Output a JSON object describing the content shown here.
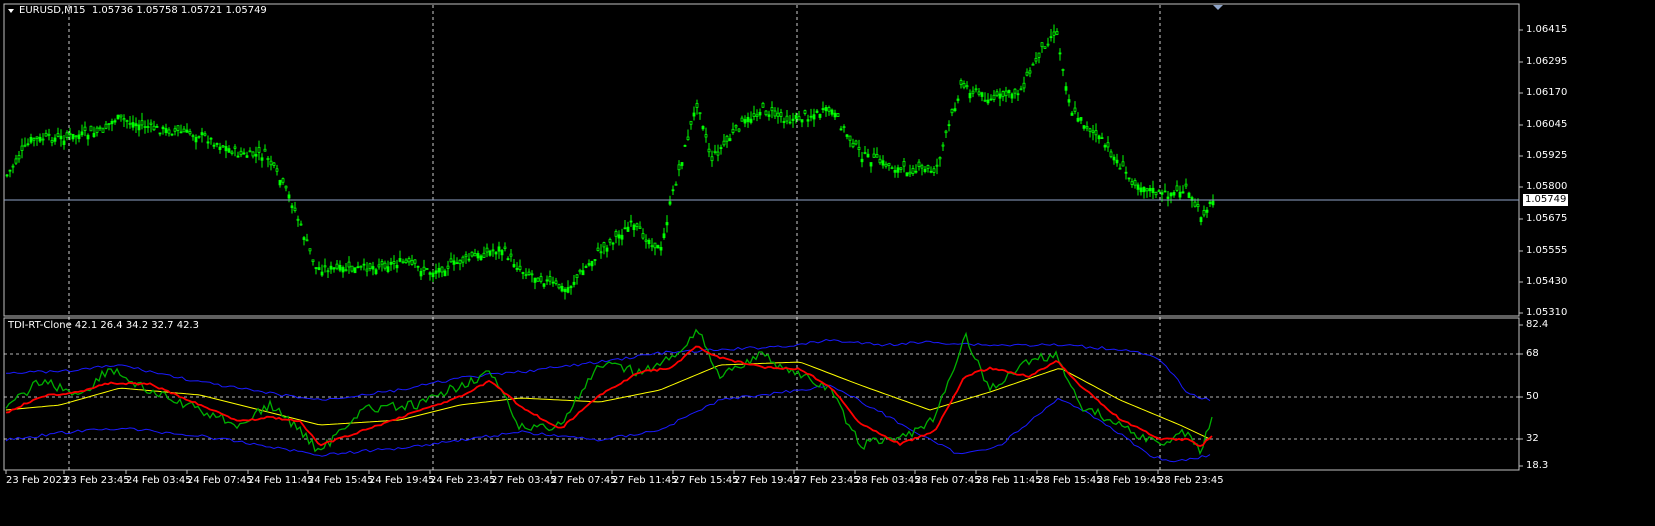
{
  "main_chart": {
    "symbol_label": "EURUSD,M15",
    "ohlc": "1.05736 1.05758 1.05721 1.05749",
    "price_labels": [
      "1.06415",
      "1.06295",
      "1.06170",
      "1.06045",
      "1.05925",
      "1.05800",
      "1.05675",
      "1.05555",
      "1.05430",
      "1.05310"
    ],
    "current_price": "1.05749",
    "colors": {
      "candle": "#00ff00",
      "grid": "#ffffff",
      "price_line": "#8fa4c8",
      "background": "#000000"
    }
  },
  "indicator": {
    "title": "TDI-RT-Clone 42.1 26.4 34.2 32.7 42.3",
    "levels": [
      "82.4",
      "68",
      "50",
      "32",
      "18.3"
    ],
    "colors": {
      "rsi": "#00b000",
      "signal": "#ff0000",
      "market_base": "#ffff00",
      "bands": "#0000ff"
    }
  },
  "time_axis": {
    "labels": [
      "23 Feb 2023",
      "23 Feb 23:45",
      "24 Feb 03:45",
      "24 Feb 07:45",
      "24 Feb 11:45",
      "24 Feb 15:45",
      "24 Feb 19:45",
      "24 Feb 23:45",
      "27 Feb 03:45",
      "27 Feb 07:45",
      "27 Feb 11:45",
      "27 Feb 15:45",
      "27 Feb 19:45",
      "27 Feb 23:45",
      "28 Feb 03:45",
      "28 Feb 07:45",
      "28 Feb 11:45",
      "28 Feb 15:45",
      "28 Feb 19:45",
      "28 Feb 23:45"
    ]
  }
}
